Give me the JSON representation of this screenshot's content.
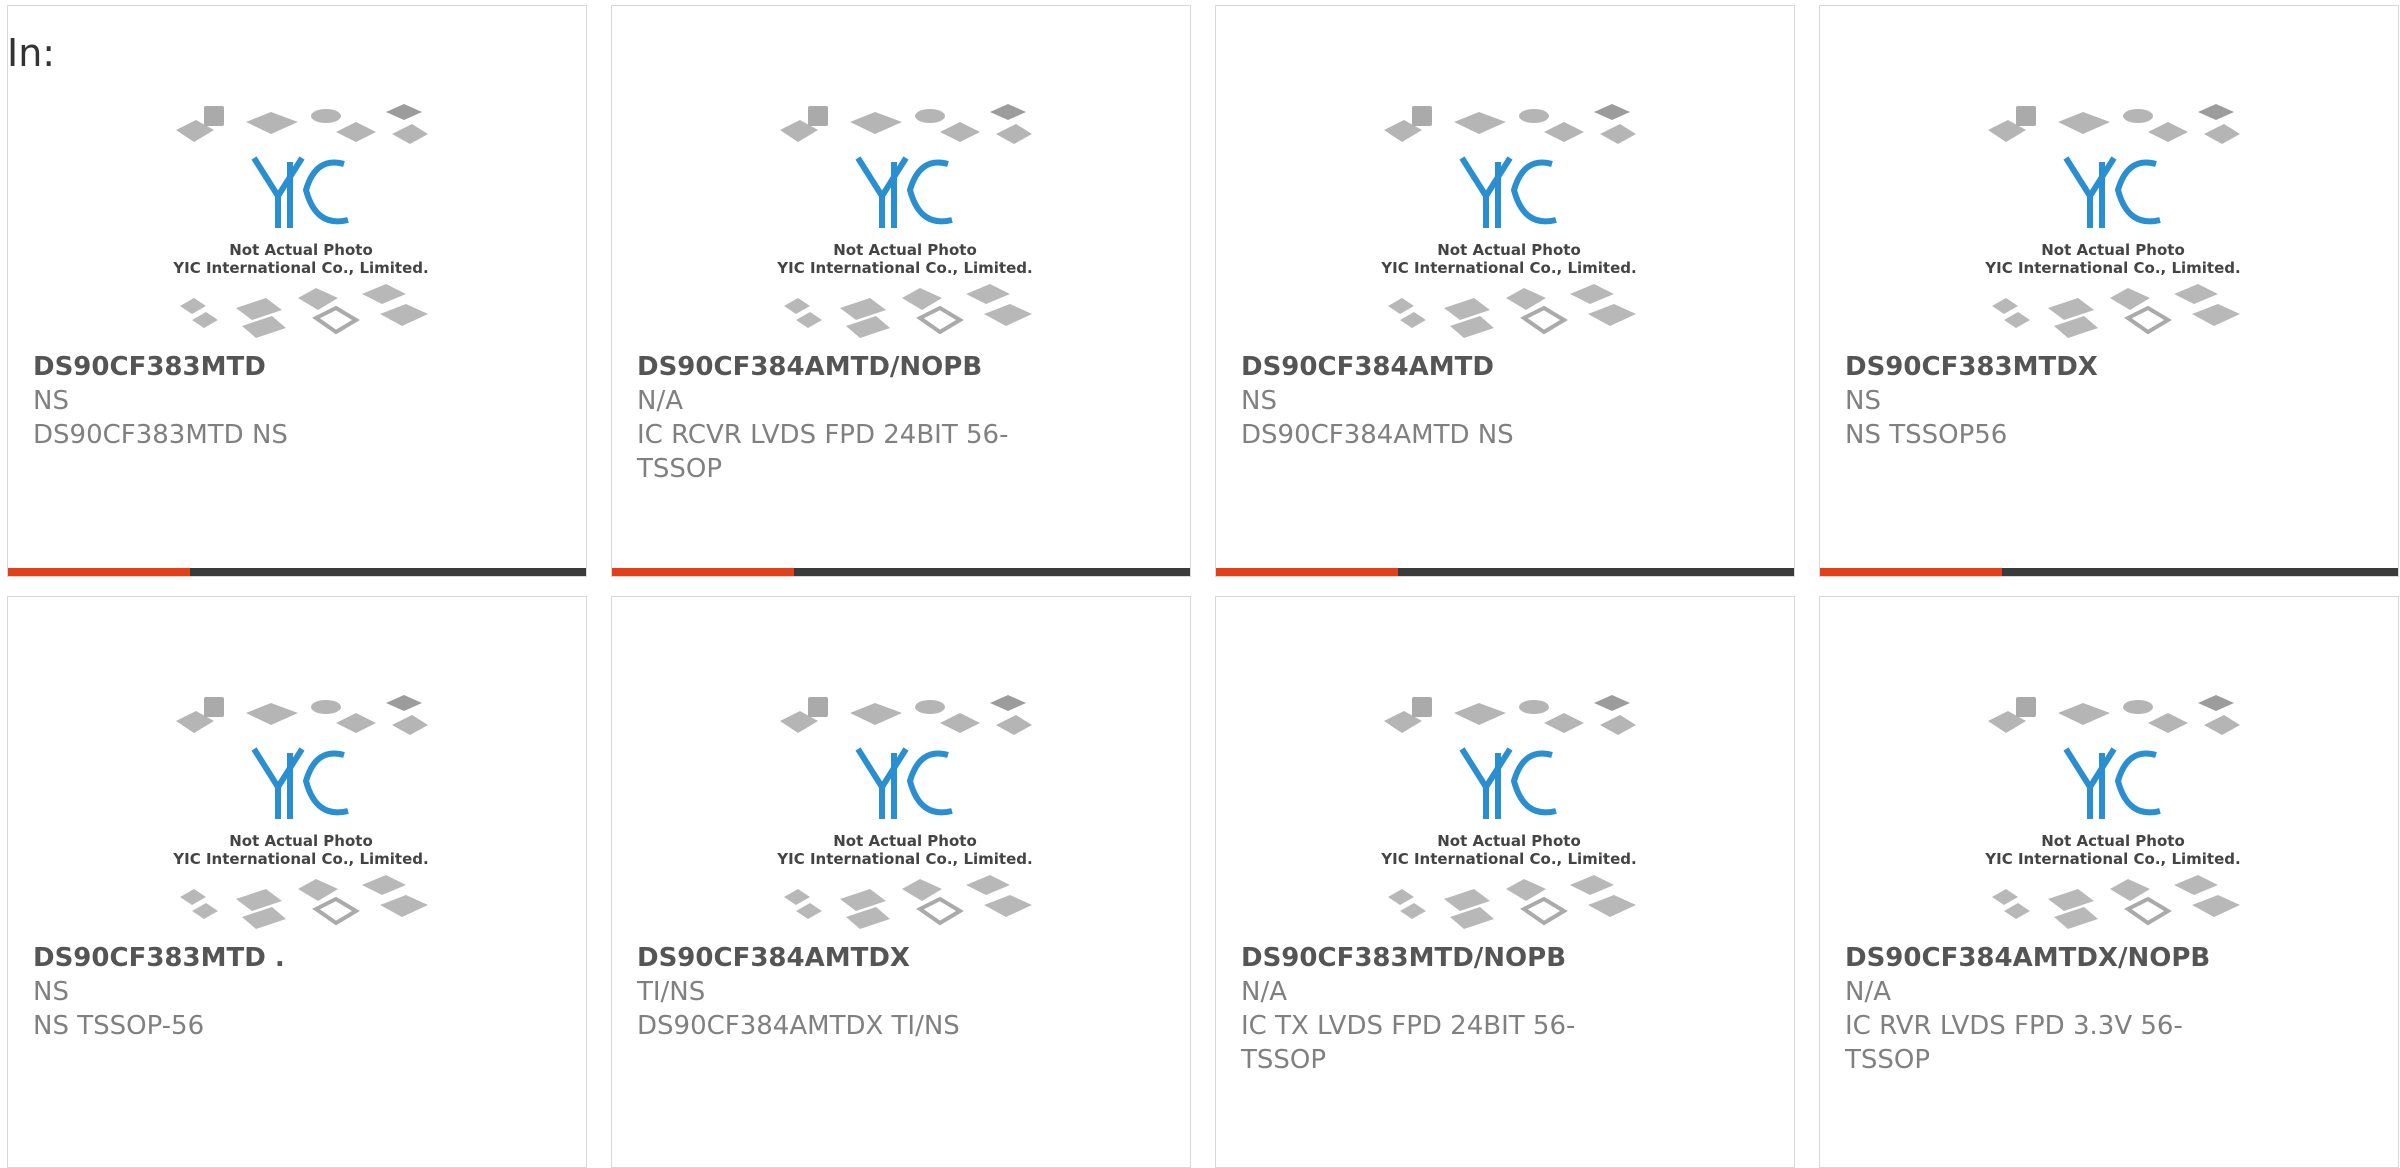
{
  "page": {
    "in_label": "In:"
  },
  "photo": {
    "caption_line1": "Not Actual Photo",
    "caption_line2": "YIC International Co., Limited.",
    "logo_text": "YIC"
  },
  "colors": {
    "accent": "#e2401b",
    "bar": "#3a3a3a",
    "logo_blue": "#2a8fd0"
  },
  "products": [
    {
      "part_number": "DS90CF383MTD",
      "manufacturer": "NS",
      "description": "DS90CF383MTD NS"
    },
    {
      "part_number": "DS90CF384AMTD/NOPB",
      "manufacturer": "N/A",
      "description": "IC RCVR LVDS FPD 24BIT 56-TSSOP"
    },
    {
      "part_number": "DS90CF384AMTD",
      "manufacturer": "NS",
      "description": "DS90CF384AMTD NS"
    },
    {
      "part_number": "DS90CF383MTDX",
      "manufacturer": "NS",
      "description": "NS TSSOP56"
    },
    {
      "part_number": "DS90CF383MTD .",
      "manufacturer": "NS",
      "description": "NS TSSOP-56"
    },
    {
      "part_number": "DS90CF384AMTDX",
      "manufacturer": "TI/NS",
      "description": "DS90CF384AMTDX TI/NS"
    },
    {
      "part_number": "DS90CF383MTD/NOPB",
      "manufacturer": "N/A",
      "description": "IC TX LVDS FPD 24BIT 56-TSSOP"
    },
    {
      "part_number": "DS90CF384AMTDX/NOPB",
      "manufacturer": "N/A",
      "description": "IC RVR LVDS FPD 3.3V 56-TSSOP"
    }
  ]
}
